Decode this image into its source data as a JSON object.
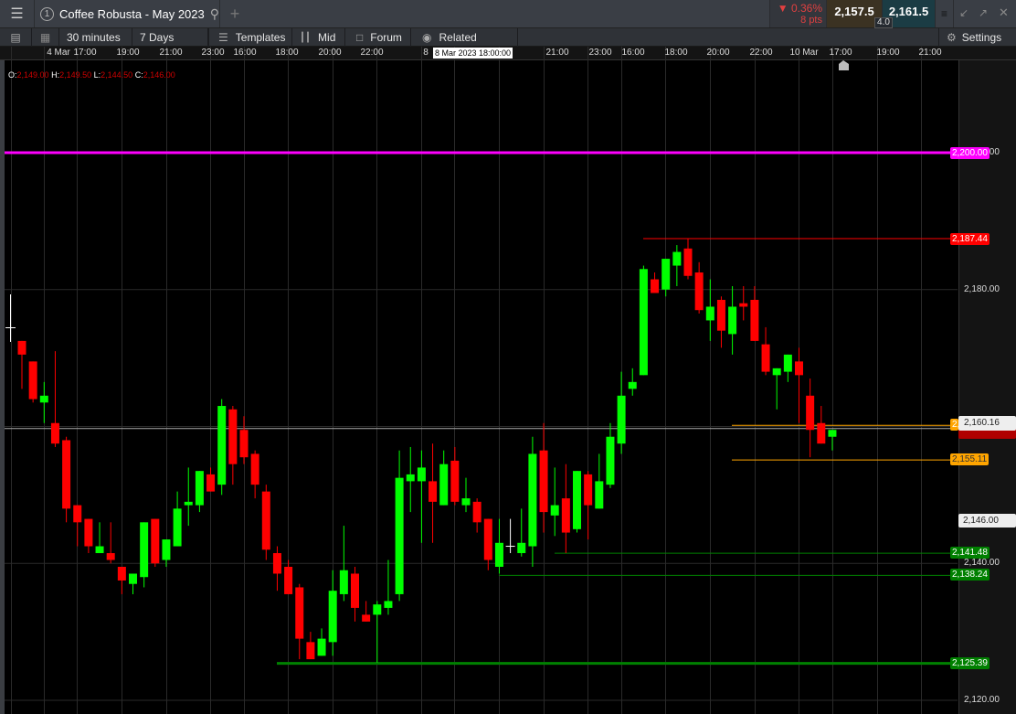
{
  "header": {
    "title": "Coffee Robusta - May 2023",
    "window_number": "1",
    "add_tab": "+",
    "change_pct": "0.36%",
    "change_pts": "8 pts",
    "bid": "2,157.5",
    "ask": "2,161.5",
    "spread": "4.0"
  },
  "toolbar": {
    "interval": "30 minutes",
    "range": "7 Days",
    "templates": "Templates",
    "price_type": "Mid",
    "forum": "Forum",
    "related": "Related",
    "settings": "Settings"
  },
  "time_axis": {
    "labels": [
      "4 Mar",
      "17:00",
      "19:00",
      "21:00",
      "23:00",
      "16:00",
      "18:00",
      "20:00",
      "22:00",
      "8",
      "21:00",
      "23:00",
      "16:00",
      "18:00",
      "20:00",
      "22:00",
      "10 Mar",
      "17:00",
      "19:00",
      "21:00"
    ],
    "tooltip": "8 Mar 2023 18:00:00"
  },
  "ohlc": {
    "o_label": "O:",
    "o": "2,149.00",
    "h_label": "H:",
    "h": "2,149.50",
    "l_label": "L:",
    "l": "2,144.50",
    "c_label": "C:",
    "c": "2,146.00"
  },
  "price_axis": {
    "labels": [
      "2,200.00",
      "2,180.00",
      "2,140.00",
      "2,120.00"
    ],
    "crosshair_price": "2,146.00",
    "last_price": "2,160.16"
  },
  "levels": [
    {
      "label": "2,200.00",
      "value": 2200.0,
      "color": "#ff00ff"
    },
    {
      "label": "2,187.44",
      "value": 2187.44,
      "color": "#ff0000"
    },
    {
      "label": "2,160.16",
      "value": 2160.16,
      "color": "#ffa500"
    },
    {
      "label": "2,155.11",
      "value": 2155.11,
      "color": "#ffa500"
    },
    {
      "label": "2,141.48",
      "value": 2141.48,
      "color": "#008000"
    },
    {
      "label": "2,138.24",
      "value": 2138.24,
      "color": "#008000"
    },
    {
      "label": "2,125.39",
      "value": 2125.39,
      "color": "#008000"
    }
  ],
  "colors": {
    "up": "#00ff00",
    "down": "#ff0000",
    "down_text": "#e04040"
  },
  "chart_data": {
    "type": "candlestick",
    "ylim": [
      2116,
      2209.5
    ],
    "yticks": [
      2200,
      2180,
      2160,
      2140,
      2120
    ],
    "current_price": 2159.7,
    "candles": [
      [
        2172.5,
        2172.5,
        2165.5,
        2170.5
      ],
      [
        2169.5,
        2169.5,
        2163.5,
        2164
      ],
      [
        2163.5,
        2166.5,
        2160.5,
        2164.5
      ],
      [
        2160.5,
        2171,
        2157,
        2157.5
      ],
      [
        2158,
        2158.5,
        2146,
        2148
      ],
      [
        2148.5,
        2148.5,
        2142.5,
        2146
      ],
      [
        2146.5,
        2146.5,
        2141.5,
        2142.5
      ],
      [
        2141.5,
        2146,
        2141.5,
        2142.5
      ],
      [
        2141.5,
        2146,
        2140,
        2140.5
      ],
      [
        2139.5,
        2139.5,
        2135.5,
        2137.5
      ],
      [
        2137,
        2138.5,
        2135.5,
        2138.5
      ],
      [
        2138,
        2146,
        2136.5,
        2146
      ],
      [
        2146.5,
        2146.5,
        2139.5,
        2140
      ],
      [
        2140.5,
        2143.5,
        2139.5,
        2143.5
      ],
      [
        2142.5,
        2150.5,
        2142.5,
        2148
      ],
      [
        2148.5,
        2154,
        2145.5,
        2149
      ],
      [
        2148.5,
        2153.5,
        2147.5,
        2153.5
      ],
      [
        2153,
        2154,
        2150.5,
        2150.5
      ],
      [
        2151.5,
        2164,
        2150,
        2163
      ],
      [
        2162.5,
        2163,
        2151.5,
        2154.5
      ],
      [
        2159.5,
        2161.5,
        2154.5,
        2155.5
      ],
      [
        2156,
        2156.5,
        2149.5,
        2151.5
      ],
      [
        2150.5,
        2151.5,
        2140.5,
        2142
      ],
      [
        2141.5,
        2142.5,
        2136,
        2138.5
      ],
      [
        2139.5,
        2140.5,
        2135.5,
        2135.5
      ],
      [
        2136.5,
        2137,
        2126,
        2129
      ],
      [
        2128.5,
        2130,
        2126,
        2126
      ],
      [
        2126.5,
        2130.5,
        2126.5,
        2129
      ],
      [
        2128.5,
        2139,
        2126.5,
        2136
      ],
      [
        2135.5,
        2145.5,
        2134.5,
        2139
      ],
      [
        2138.5,
        2139.5,
        2131.5,
        2133.5
      ],
      [
        2132.5,
        2134.5,
        2131.5,
        2131.5
      ],
      [
        2132.5,
        2134.5,
        2125.5,
        2134
      ],
      [
        2133.5,
        2140.5,
        2132.5,
        2134.5
      ],
      [
        2135.5,
        2156.5,
        2134.5,
        2152.5
      ],
      [
        2152,
        2157,
        2147.5,
        2153
      ],
      [
        2152,
        2156.5,
        2143,
        2154
      ],
      [
        2152,
        2157.5,
        2143,
        2149
      ],
      [
        2148.5,
        2156.5,
        2148.5,
        2154.5
      ],
      [
        2155,
        2157,
        2148.5,
        2149
      ],
      [
        2148.5,
        2152.5,
        2147.5,
        2149.5
      ],
      [
        2149,
        2149.5,
        2144.5,
        2146
      ],
      [
        2146.5,
        2146.5,
        2139,
        2140.5
      ],
      [
        2139.5,
        2146.5,
        2138.5,
        2143
      ],
      [
        2142.5,
        2146.5,
        2141.5,
        2142.5
      ],
      [
        2141.5,
        2148,
        2141,
        2143
      ],
      [
        2142.5,
        2158.5,
        2139.5,
        2156
      ],
      [
        2156.5,
        2160.5,
        2144.5,
        2147.5
      ],
      [
        2147,
        2154,
        2144,
        2148.5
      ],
      [
        2149.5,
        2154.5,
        2141.5,
        2144.5
      ],
      [
        2145,
        2153.5,
        2144.5,
        2153.5
      ],
      [
        2153,
        2153.5,
        2143.5,
        2148.5
      ],
      [
        2148,
        2156,
        2148,
        2152
      ],
      [
        2151.5,
        2160.5,
        2151,
        2158.5
      ],
      [
        2157.5,
        2168,
        2156,
        2164.5
      ],
      [
        2165.5,
        2168.5,
        2164.5,
        2166.5
      ],
      [
        2167.5,
        2183.5,
        2167.5,
        2183
      ],
      [
        2181.5,
        2182.5,
        2179.5,
        2179.5
      ],
      [
        2180,
        2184.5,
        2179,
        2184.5
      ],
      [
        2183.5,
        2186.5,
        2180.5,
        2185.5
      ],
      [
        2186,
        2187.5,
        2181.5,
        2182
      ],
      [
        2182.5,
        2184,
        2176.5,
        2177
      ],
      [
        2175.5,
        2181.5,
        2172.5,
        2177.5
      ],
      [
        2178.5,
        2179,
        2171.5,
        2174
      ],
      [
        2173.5,
        2180.5,
        2170.5,
        2177.5
      ],
      [
        2178,
        2180.5,
        2175.5,
        2177.5
      ],
      [
        2178.5,
        2180.5,
        2172.5,
        2172.5
      ],
      [
        2172,
        2174.5,
        2167.5,
        2168
      ],
      [
        2167.5,
        2168.5,
        2162.5,
        2168.5
      ],
      [
        2168,
        2170.5,
        2166.5,
        2170.5
      ],
      [
        2169.5,
        2171.5,
        2160.5,
        2167.5
      ],
      [
        2164.5,
        2167,
        2155.5,
        2159.5
      ],
      [
        2160.5,
        2163,
        2157.5,
        2157.5
      ],
      [
        2158.5,
        2159.5,
        2156.5,
        2159.5
      ]
    ]
  }
}
